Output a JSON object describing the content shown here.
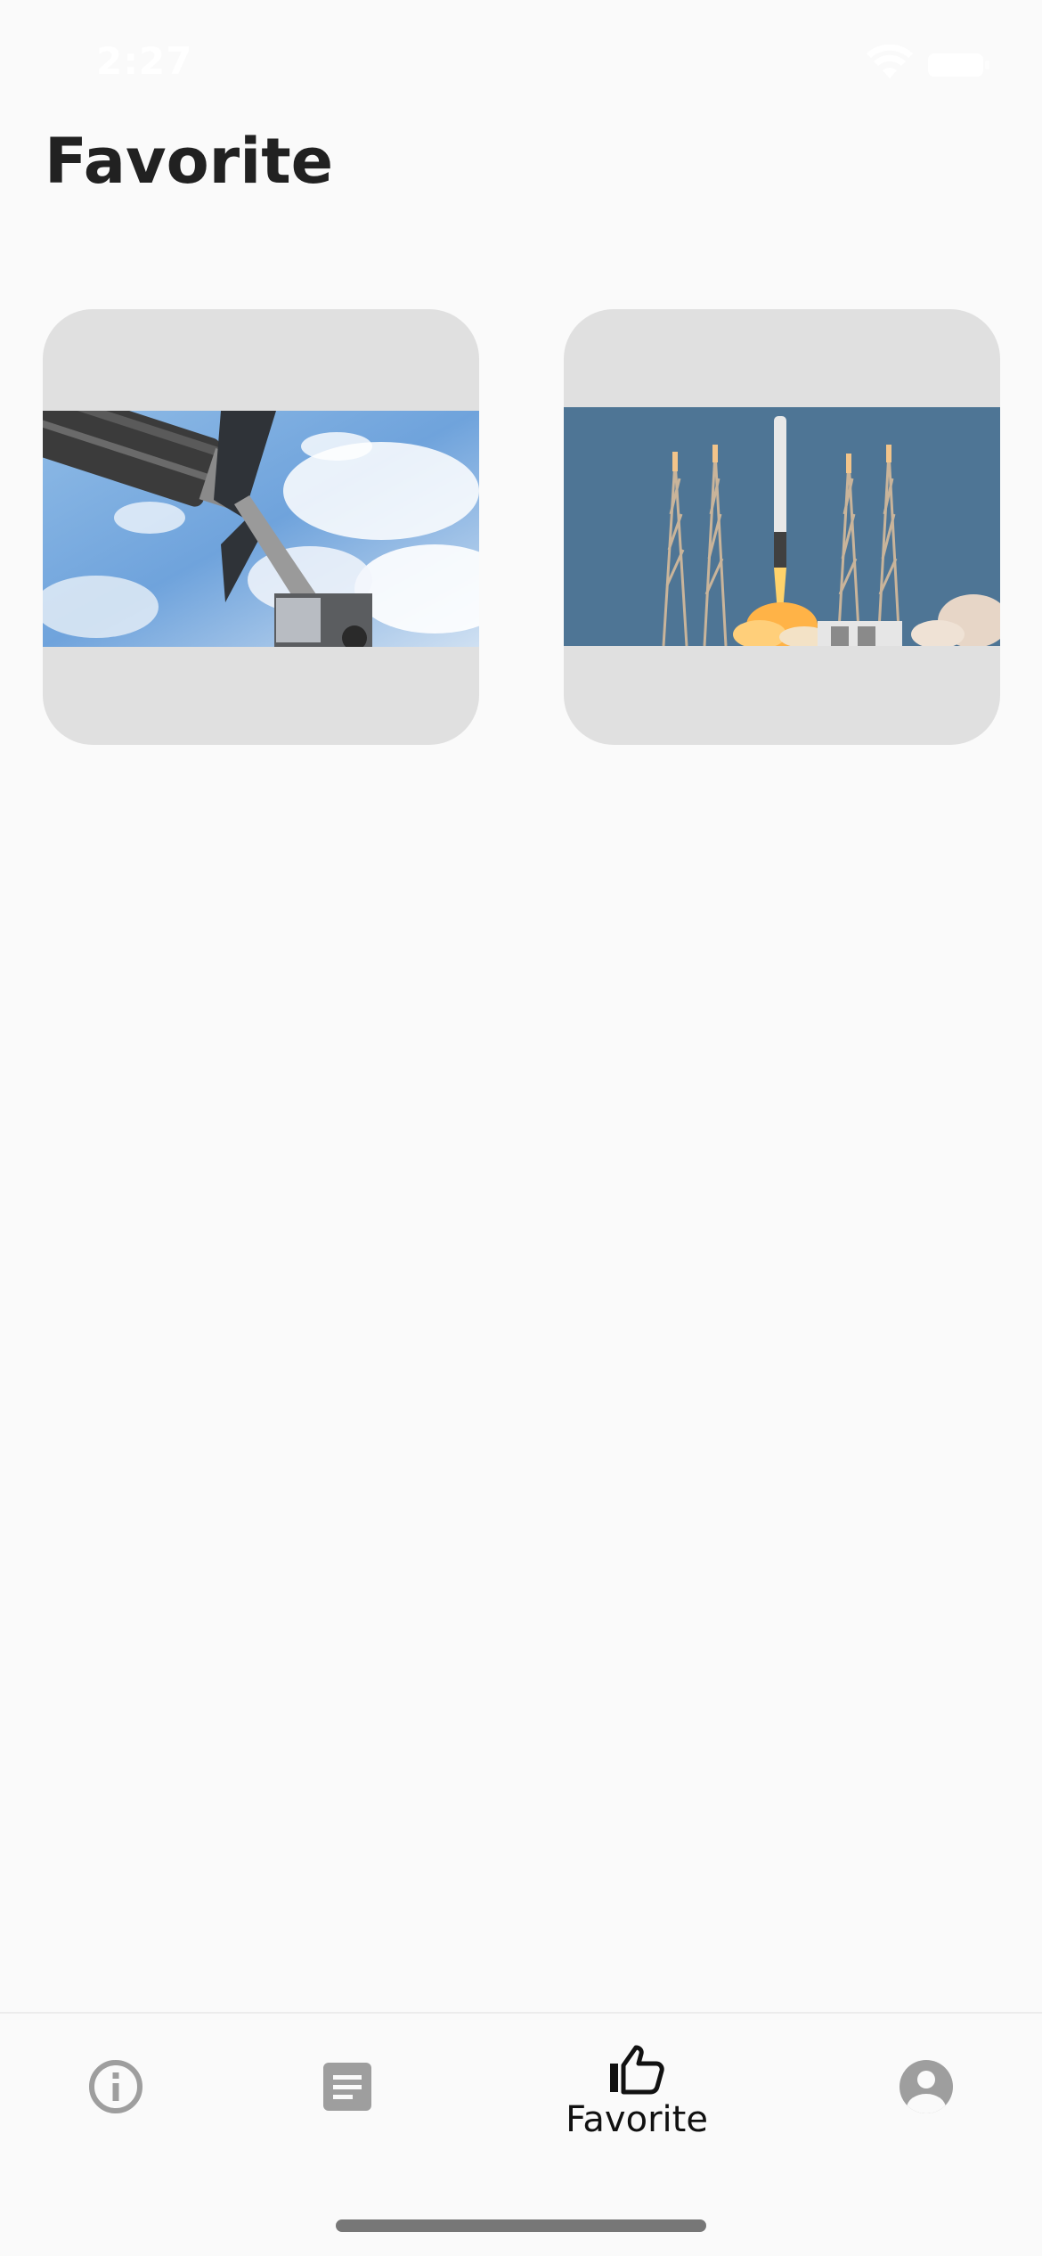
{
  "status_bar": {
    "time": "2:27",
    "icons": [
      "wifi-icon",
      "battery-icon"
    ]
  },
  "page": {
    "title": "Favorite"
  },
  "favorites": [
    {
      "image": "spacecraft-robotic-arm-over-earth",
      "image_alt": ""
    },
    {
      "image": "rocket-launch-pad-liftoff",
      "image_alt": ""
    }
  ],
  "bottom_nav": {
    "items": [
      {
        "icon": "info-icon",
        "label": "",
        "active": false
      },
      {
        "icon": "article-icon",
        "label": "",
        "active": false
      },
      {
        "icon": "thumb-up-icon",
        "label": "Favorite",
        "active": true
      },
      {
        "icon": "account-circle-icon",
        "label": "",
        "active": false
      }
    ],
    "active_color": "#111111",
    "inactive_color": "#9e9e9e"
  },
  "colors": {
    "background": "#fafafa",
    "card_background": "#e0e0e0",
    "title_text": "#212121"
  }
}
